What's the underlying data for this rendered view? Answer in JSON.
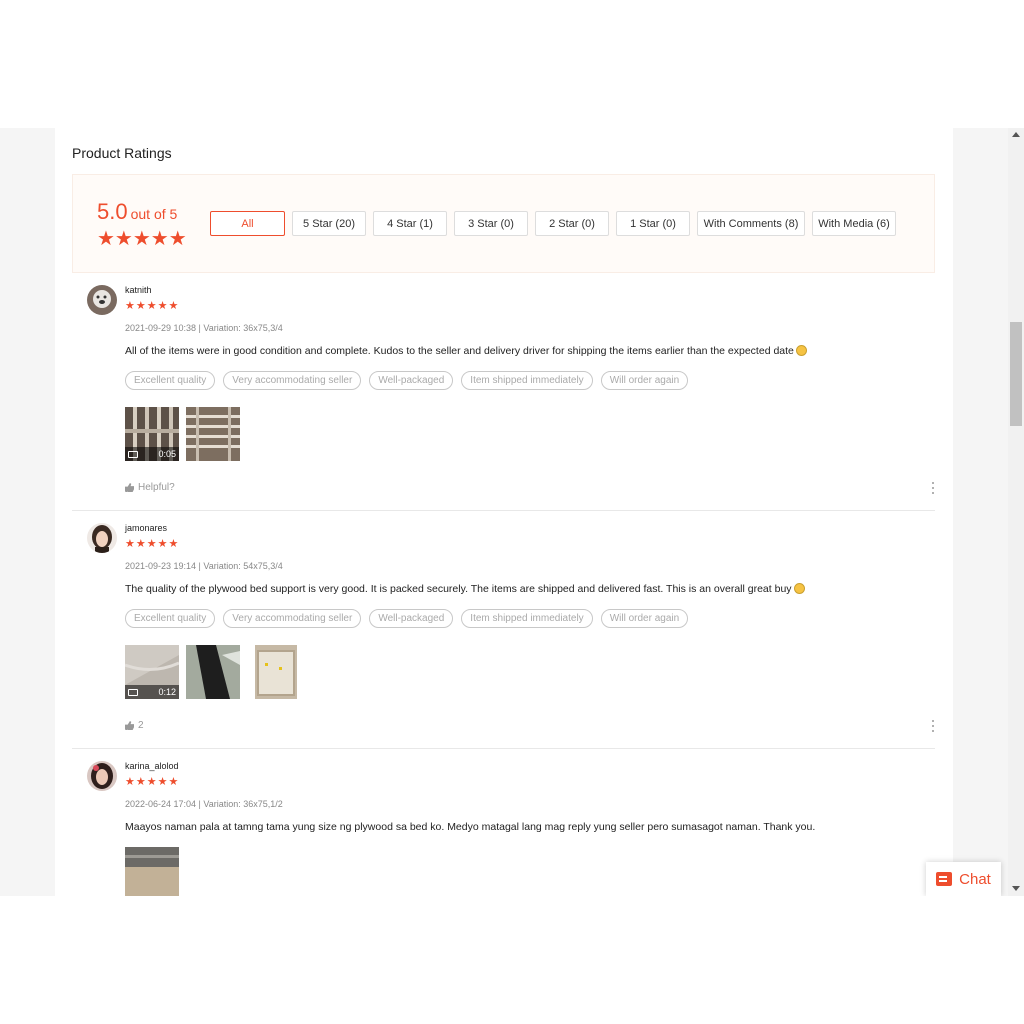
{
  "section": {
    "title": "Product Ratings"
  },
  "overview": {
    "score": "5.0",
    "out_of": "out of 5",
    "stars": "★★★★★",
    "filters": [
      "All",
      "5 Star (20)",
      "4 Star (1)",
      "3 Star (0)",
      "2 Star (0)",
      "1 Star (0)",
      "With Comments (8)",
      "With Media (6)"
    ]
  },
  "reviews": [
    {
      "author": "katnith",
      "stars": "★★★★★",
      "meta": "2021-09-29 10:38 | Variation: 36x75,3/4",
      "comment": "All of the items were in good condition and complete. Kudos to the seller and delivery driver for shipping the items earlier than the expected date",
      "tags": [
        "Excellent quality",
        "Very accommodating seller",
        "Well-packaged",
        "Item shipped immediately",
        "Will order again"
      ],
      "video_duration": "0:05",
      "helpful": "Helpful?"
    },
    {
      "author": "jamonares",
      "stars": "★★★★★",
      "meta": "2021-09-23 19:14 | Variation: 54x75,3/4",
      "comment": "The quality of the plywood bed support is very good. It is packed securely. The items are shipped and delivered fast. This is an overall great buy",
      "tags": [
        "Excellent quality",
        "Very accommodating seller",
        "Well-packaged",
        "Item shipped immediately",
        "Will order again"
      ],
      "video_duration": "0:12",
      "helpful": "2"
    },
    {
      "author": "karina_alolod",
      "stars": "★★★★★",
      "meta": "2022-06-24 17:04 | Variation: 36x75,1/2",
      "comment": "Maayos naman pala at tamng tama yung size ng plywood sa bed ko. Medyo matagal lang mag reply yung seller pero sumasagot naman. Thank you."
    }
  ],
  "chat": {
    "label": "Chat"
  },
  "colors": {
    "accent": "#ee4d2d"
  }
}
